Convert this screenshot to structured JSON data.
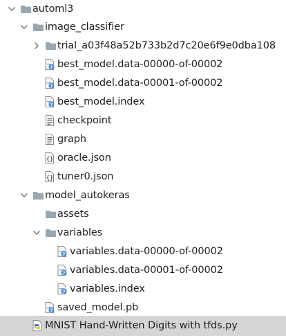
{
  "tree": {
    "root": {
      "label": "automl3",
      "expanded": true,
      "icon": "folder-icon"
    },
    "image_classifier": {
      "label": "image_classifier",
      "expanded": true,
      "icon": "folder-icon",
      "trial": {
        "label": "trial_a03f48a52b733b2d7c20e6f9e0dba108",
        "expanded": false,
        "icon": "folder-icon"
      },
      "files": [
        {
          "label": "best_model.data-00000-of-00002",
          "icon": "unknown-file-icon"
        },
        {
          "label": "best_model.data-00001-of-00002",
          "icon": "unknown-file-icon"
        },
        {
          "label": "best_model.index",
          "icon": "unknown-file-icon"
        },
        {
          "label": "checkpoint",
          "icon": "text-file-icon"
        },
        {
          "label": "graph",
          "icon": "text-file-icon"
        },
        {
          "label": "oracle.json",
          "icon": "json-file-icon"
        },
        {
          "label": "tuner0.json",
          "icon": "json-file-icon"
        }
      ]
    },
    "model_autokeras": {
      "label": "model_autokeras",
      "expanded": true,
      "icon": "folder-icon",
      "assets": {
        "label": "assets",
        "icon": "folder-icon"
      },
      "variables": {
        "label": "variables",
        "expanded": true,
        "icon": "folder-icon",
        "files": [
          {
            "label": "variables.data-00000-of-00002",
            "icon": "unknown-file-icon"
          },
          {
            "label": "variables.data-00001-of-00002",
            "icon": "unknown-file-icon"
          },
          {
            "label": "variables.index",
            "icon": "unknown-file-icon"
          }
        ]
      },
      "saved_model": {
        "label": "saved_model.pb",
        "icon": "unknown-file-icon"
      }
    },
    "script": {
      "label": "MNIST Hand-Written Digits with tfds.py",
      "icon": "python-file-icon",
      "selected": true
    }
  },
  "colors": {
    "folder": "#9aa7b0",
    "selection": "#d5d5d5",
    "text": "#1e1e1e",
    "python_blue": "#3b78b8",
    "python_yellow": "#f2c94c",
    "unknown_mark": "#4a8ed8"
  }
}
